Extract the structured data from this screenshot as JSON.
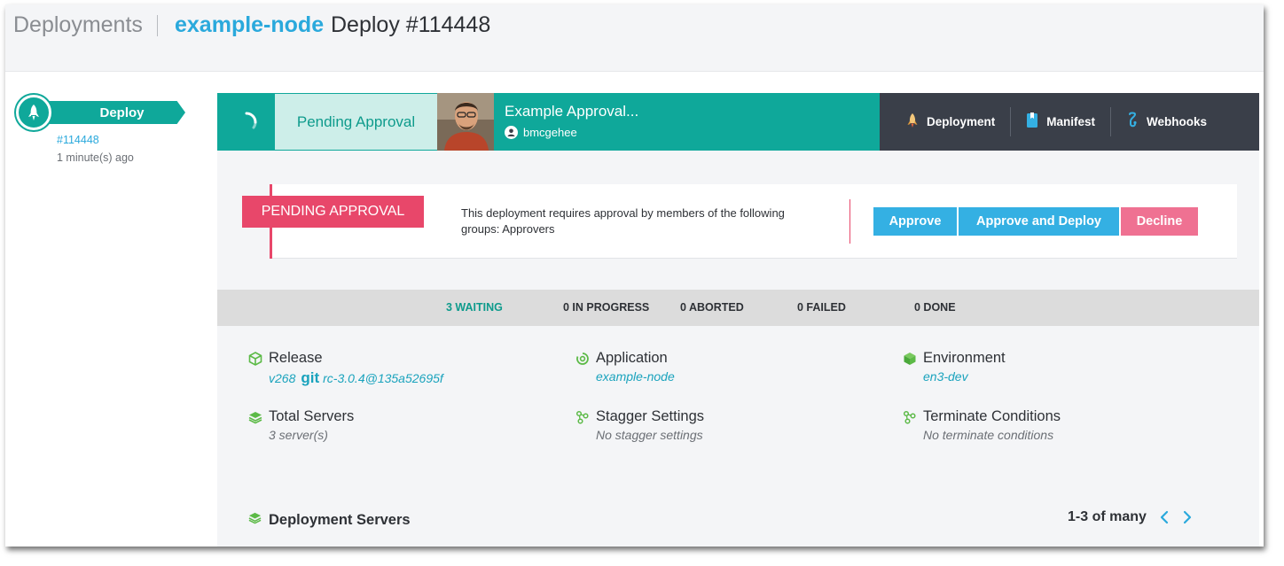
{
  "header": {
    "root": "Deployments",
    "app_name": "example-node",
    "deploy_title": "Deploy #114448"
  },
  "sidebar": {
    "stage_label": "Deploy",
    "deploy_number": "#114448",
    "time_ago": "1 minute(s) ago"
  },
  "status_bar": {
    "state": "Pending Approval",
    "title": "Example Approval...",
    "user": "bmcgehee"
  },
  "nav": {
    "deployment": "Deployment",
    "manifest": "Manifest",
    "webhooks": "Webhooks"
  },
  "approval": {
    "tag": "PENDING APPROVAL",
    "message": "This deployment requires approval by members of the following groups: Approvers",
    "approve": "Approve",
    "approve_and_deploy": "Approve and Deploy",
    "decline": "Decline"
  },
  "counts": {
    "waiting": "3 WAITING",
    "in_progress": "0 IN PROGRESS",
    "aborted": "0 ABORTED",
    "failed": "0 FAILED",
    "done": "0 DONE"
  },
  "details": {
    "release": {
      "label": "Release",
      "version": "v268",
      "git": "git",
      "ref": "rc-3.0.4@135a52695f"
    },
    "application": {
      "label": "Application",
      "value": "example-node"
    },
    "environment": {
      "label": "Environment",
      "value": "en3-dev"
    },
    "total_servers": {
      "label": "Total Servers",
      "value": "3 server(s)"
    },
    "stagger": {
      "label": "Stagger Settings",
      "value": "No stagger settings"
    },
    "terminate": {
      "label": "Terminate Conditions",
      "value": "No terminate conditions"
    }
  },
  "servers": {
    "title": "Deployment Servers",
    "pager": "1-3 of many"
  },
  "colors": {
    "teal": "#0fa89a",
    "blue": "#34b0e3",
    "pink": "#e8476a",
    "dark_nav": "#3a3f49"
  }
}
